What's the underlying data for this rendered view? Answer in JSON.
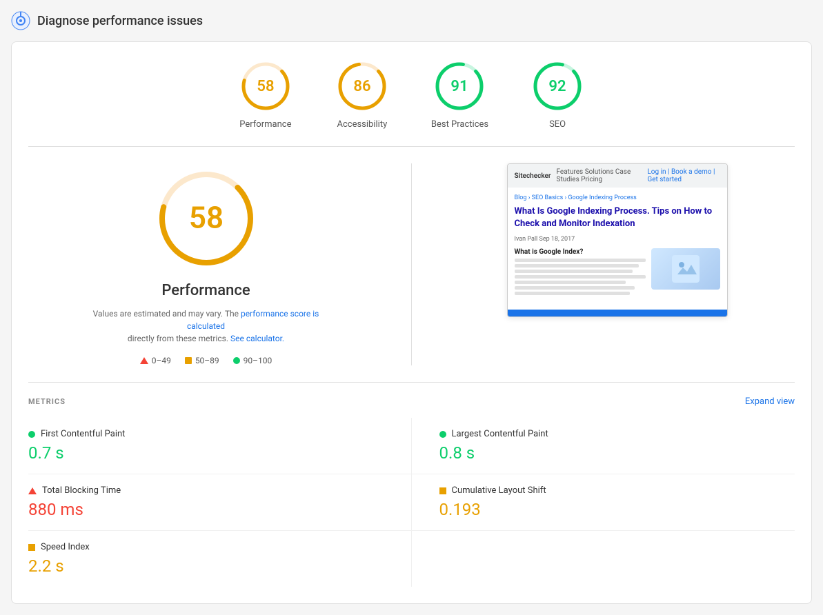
{
  "header": {
    "title": "Diagnose performance issues",
    "icon_color": "#4285f4"
  },
  "scores": [
    {
      "id": "performance",
      "value": 58,
      "label": "Performance",
      "color": "#e8a000",
      "track_color": "#fce8cc",
      "angle": 209
    },
    {
      "id": "accessibility",
      "value": 86,
      "label": "Accessibility",
      "color": "#e8a000",
      "track_color": "#fce8cc",
      "angle": 310
    },
    {
      "id": "best-practices",
      "value": 91,
      "label": "Best Practices",
      "color": "#0cce6b",
      "track_color": "#c8f5e0",
      "angle": 328
    },
    {
      "id": "seo",
      "value": 92,
      "label": "SEO",
      "color": "#0cce6b",
      "track_color": "#c8f5e0",
      "angle": 331
    }
  ],
  "main_score": {
    "value": "58",
    "label": "Performance",
    "note_prefix": "Values are estimated and may vary. The",
    "note_link_text": "performance score is calculated",
    "note_suffix": "directly from these metrics.",
    "calc_link": "See calculator.",
    "color": "#e8a000"
  },
  "legend": [
    {
      "range": "0–49",
      "type": "triangle"
    },
    {
      "range": "50–89",
      "type": "square"
    },
    {
      "range": "90–100",
      "type": "circle"
    }
  ],
  "screenshot": {
    "nav_text": "Blog › SEO Basics › Google Indexing Process",
    "title": "What Is Google Indexing Process. Tips on How to Check and Monitor Indexation",
    "meta": "Ivan Pall    Sep 18, 2017",
    "heading": "What is Google Index?",
    "footer_color": "#1a73e8"
  },
  "metrics_section": {
    "title": "METRICS",
    "expand_label": "Expand view",
    "items": [
      {
        "id": "fcp",
        "name": "First Contentful Paint",
        "value": "0.7 s",
        "indicator": "green",
        "color_class": "green"
      },
      {
        "id": "lcp",
        "name": "Largest Contentful Paint",
        "value": "0.8 s",
        "indicator": "green",
        "color_class": "green"
      },
      {
        "id": "tbt",
        "name": "Total Blocking Time",
        "value": "880 ms",
        "indicator": "red",
        "color_class": "red"
      },
      {
        "id": "cls",
        "name": "Cumulative Layout Shift",
        "value": "0.193",
        "indicator": "orange",
        "color_class": "orange"
      },
      {
        "id": "si",
        "name": "Speed Index",
        "value": "2.2 s",
        "indicator": "orange",
        "color_class": "orange"
      }
    ]
  }
}
